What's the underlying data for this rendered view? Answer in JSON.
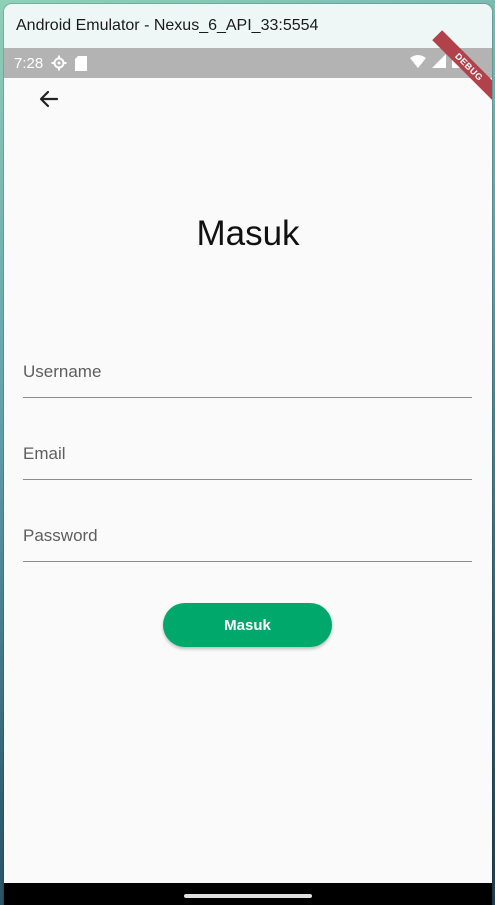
{
  "window": {
    "title": "Android Emulator - Nexus_6_API_33:5554"
  },
  "status_bar": {
    "time": "7:28"
  },
  "debug_banner": {
    "label": "DEBUG"
  },
  "page": {
    "heading": "Masuk",
    "fields": {
      "username": {
        "placeholder": "Username"
      },
      "email": {
        "placeholder": "Email"
      },
      "password": {
        "placeholder": "Password"
      }
    },
    "submit_label": "Masuk"
  },
  "colors": {
    "button": "#00a86b",
    "status_bar": "#b3b3b3",
    "debug_ribbon": "#b1414a"
  }
}
